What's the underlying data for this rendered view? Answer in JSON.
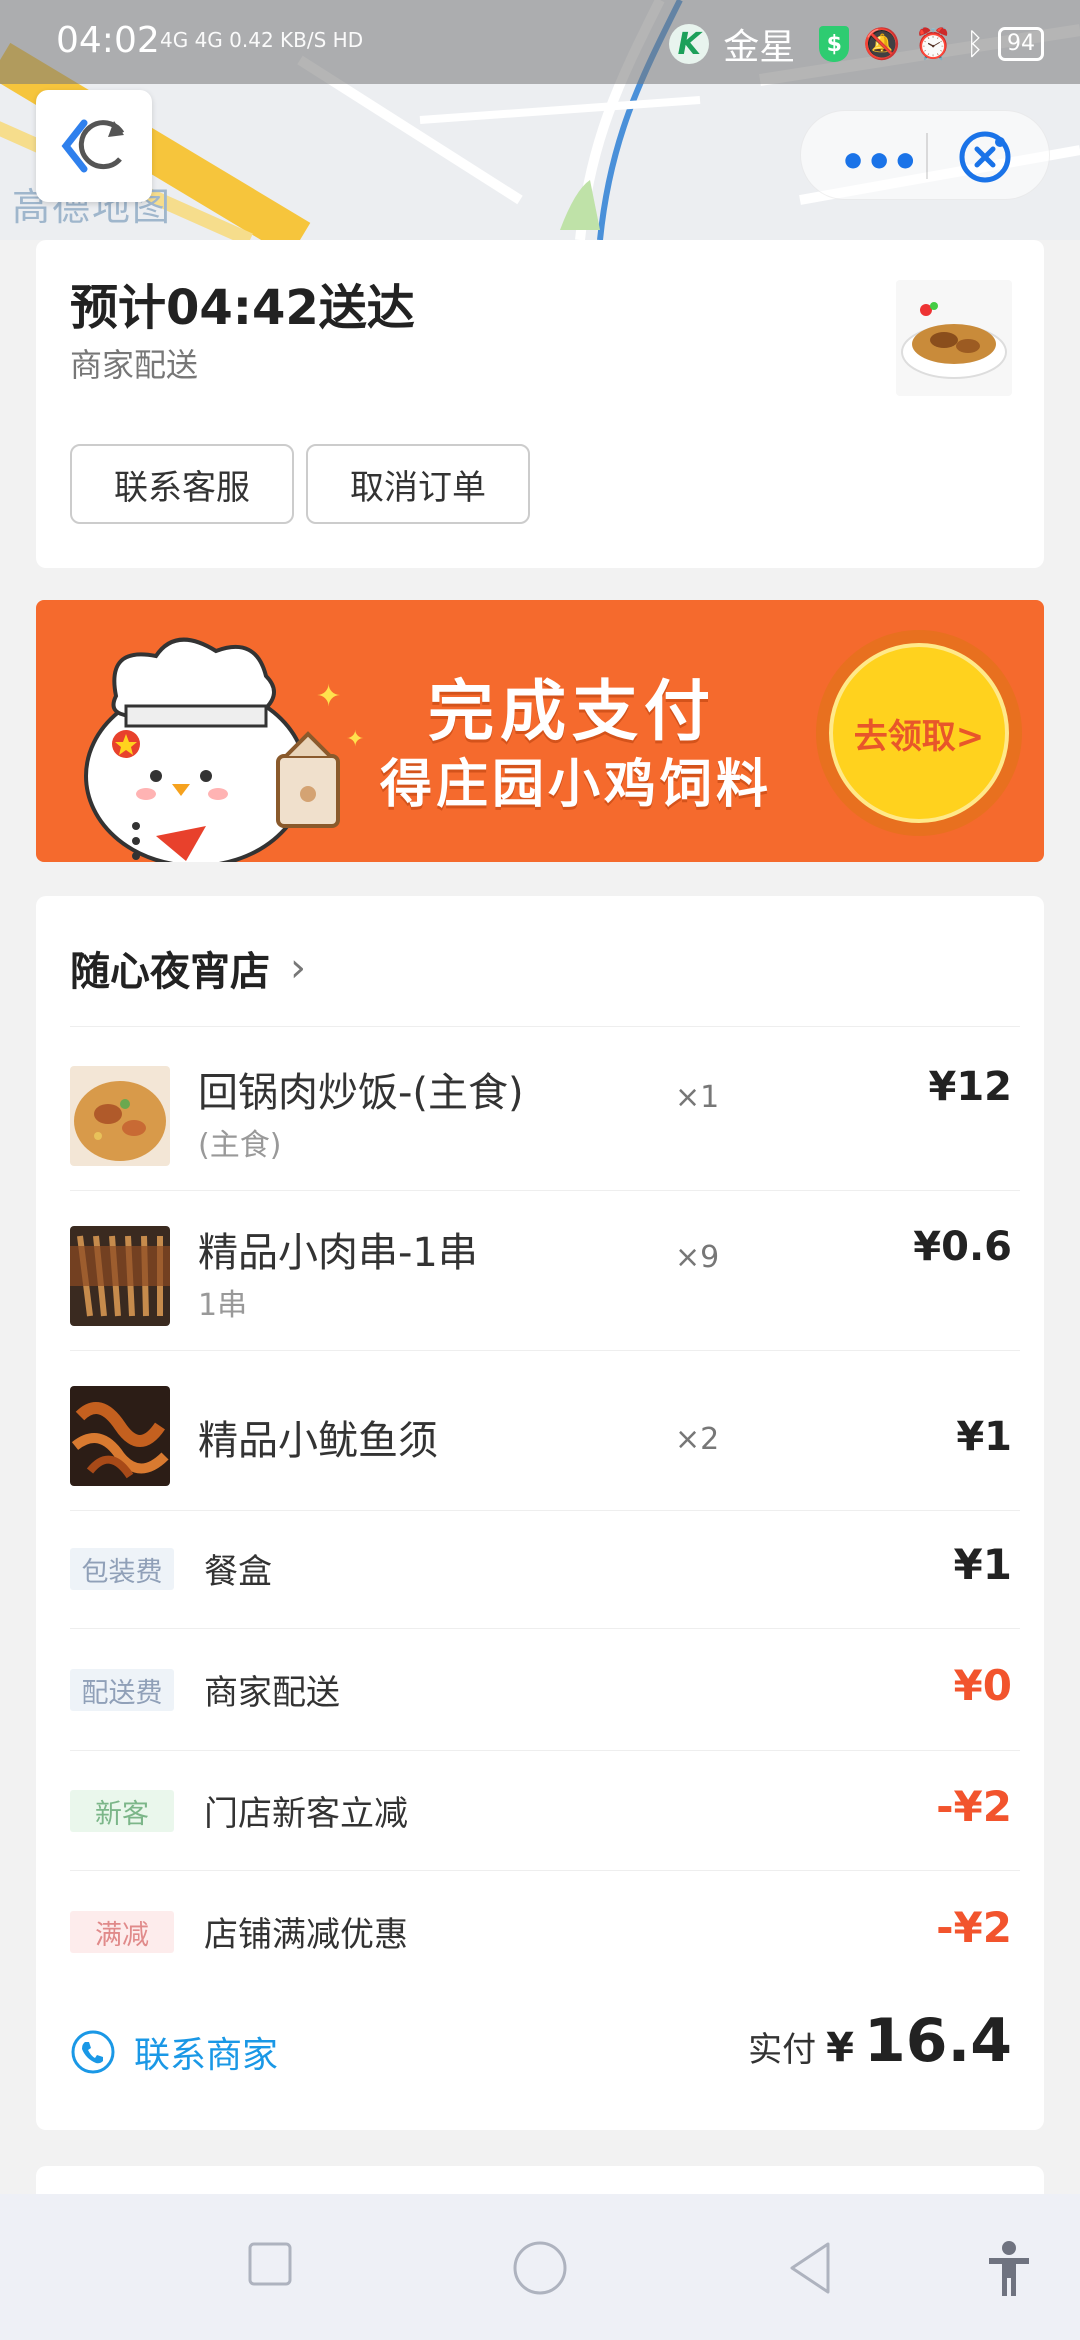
{
  "status_bar": {
    "time": "04:02",
    "network": "4G 4G 0.42 KB/S HD",
    "carrier": "金星",
    "battery": "94"
  },
  "map": {
    "watermark": "高德地图"
  },
  "delivery": {
    "eta": "预计04:42送达",
    "type": "商家配送",
    "contact_service_label": "联系客服",
    "cancel_order_label": "取消订单"
  },
  "banner": {
    "title": "完成支付",
    "subtitle": "得庄园小鸡饲料",
    "cta": "去领取>"
  },
  "order": {
    "store_name": "随心夜宵店",
    "items": [
      {
        "name": "回锅肉炒饭-(主食)",
        "spec": "(主食)",
        "qty": "×1",
        "price": "¥12"
      },
      {
        "name": "精品小肉串-1串",
        "spec": "1串",
        "qty": "×9",
        "price": "¥0.6"
      },
      {
        "name": "精品小鱿鱼须",
        "spec": "",
        "qty": "×2",
        "price": "¥1"
      }
    ],
    "fees": [
      {
        "tag": "包装费",
        "label": "餐盒",
        "amount": "¥1"
      },
      {
        "tag": "配送费",
        "label": "商家配送",
        "amount": "¥0"
      },
      {
        "tag": "新客",
        "label": "门店新客立减",
        "amount": "-¥2"
      },
      {
        "tag": "满减",
        "label": "店铺满减优惠",
        "amount": "-¥2"
      }
    ],
    "contact_store_label": "联系商家",
    "paid_label": "实付",
    "paid_currency": "¥",
    "paid_amount": "16.4"
  },
  "colors": {
    "accent_blue": "#1a98e6",
    "discount_red": "#f2542d",
    "banner_orange": "#f56a2d"
  }
}
